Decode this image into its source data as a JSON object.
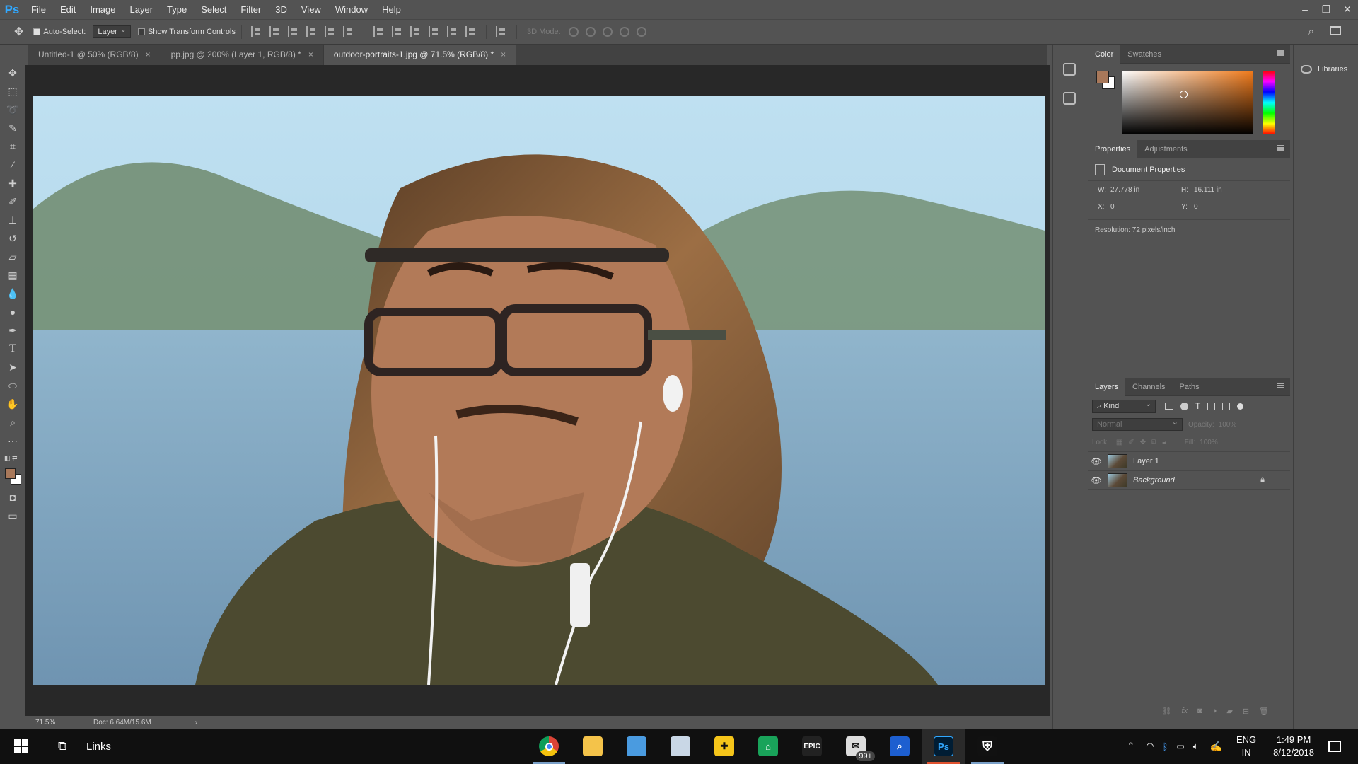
{
  "app": {
    "logo": "Ps",
    "menus": [
      "File",
      "Edit",
      "Image",
      "Layer",
      "Type",
      "Select",
      "Filter",
      "3D",
      "View",
      "Window",
      "Help"
    ]
  },
  "window_controls": [
    "minimize-icon",
    "restore-icon",
    "close-icon"
  ],
  "options_bar": {
    "auto_select_label": "Auto-Select:",
    "auto_select_value": "Layer",
    "show_transform_label": "Show Transform Controls",
    "mode_3d_label": "3D Mode:"
  },
  "tabs": [
    {
      "label": "Untitled-1 @ 50% (RGB/8)",
      "active": false
    },
    {
      "label": "pp.jpg @ 200% (Layer 1, RGB/8) *",
      "active": false
    },
    {
      "label": "outdoor-portraits-1.jpg @ 71.5% (RGB/8) *",
      "active": true
    }
  ],
  "tools": [
    "move-tool",
    "marquee-tool",
    "lasso-tool",
    "quick-select-tool",
    "crop-tool",
    "eyedropper-tool",
    "healing-brush-tool",
    "brush-tool",
    "clone-stamp-tool",
    "history-brush-tool",
    "eraser-tool",
    "gradient-tool",
    "blur-tool",
    "dodge-tool",
    "pen-tool",
    "type-tool",
    "path-select-tool",
    "shape-tool",
    "hand-tool",
    "zoom-tool",
    "more-tools"
  ],
  "colors": {
    "foreground": "#a8785a",
    "background": "#ffffff",
    "accent": "#31a8ff"
  },
  "status": {
    "zoom": "71.5%",
    "doc": "Doc: 6.64M/15.6M"
  },
  "color_panel": {
    "tabs": [
      "Color",
      "Swatches"
    ],
    "active": "Color"
  },
  "properties_panel": {
    "tabs": [
      "Properties",
      "Adjustments"
    ],
    "title": "Document Properties",
    "w_label": "W:",
    "w_value": "27.778 in",
    "h_label": "H:",
    "h_value": "16.111 in",
    "x_label": "X:",
    "x_value": "0",
    "y_label": "Y:",
    "y_value": "0",
    "resolution": "Resolution: 72 pixels/inch"
  },
  "layers_panel": {
    "tabs": [
      "Layers",
      "Channels",
      "Paths"
    ],
    "kind_label": "Kind",
    "blend_mode": "Normal",
    "opacity_label": "Opacity:",
    "opacity_value": "100%",
    "lock_label": "Lock:",
    "fill_label": "Fill:",
    "fill_value": "100%",
    "layers": [
      {
        "name": "Layer 1",
        "locked": false
      },
      {
        "name": "Background",
        "locked": true
      }
    ]
  },
  "libraries_label": "Libraries",
  "taskbar": {
    "links_label": "Links",
    "apps": [
      "chrome-icon",
      "file-explorer-icon",
      "outlook-icon",
      "mail-icon",
      "norton-icon",
      "green-app-icon",
      "epic-games-icon",
      "mail-badge-icon",
      "search-app-icon",
      "photoshop-icon",
      "shield-app-icon"
    ],
    "epic_label": "EPIC",
    "ps_label": "Ps",
    "badge": "99+",
    "lang_top": "ENG",
    "lang_bottom": "IN",
    "time": "1:49 PM",
    "date": "8/12/2018"
  }
}
